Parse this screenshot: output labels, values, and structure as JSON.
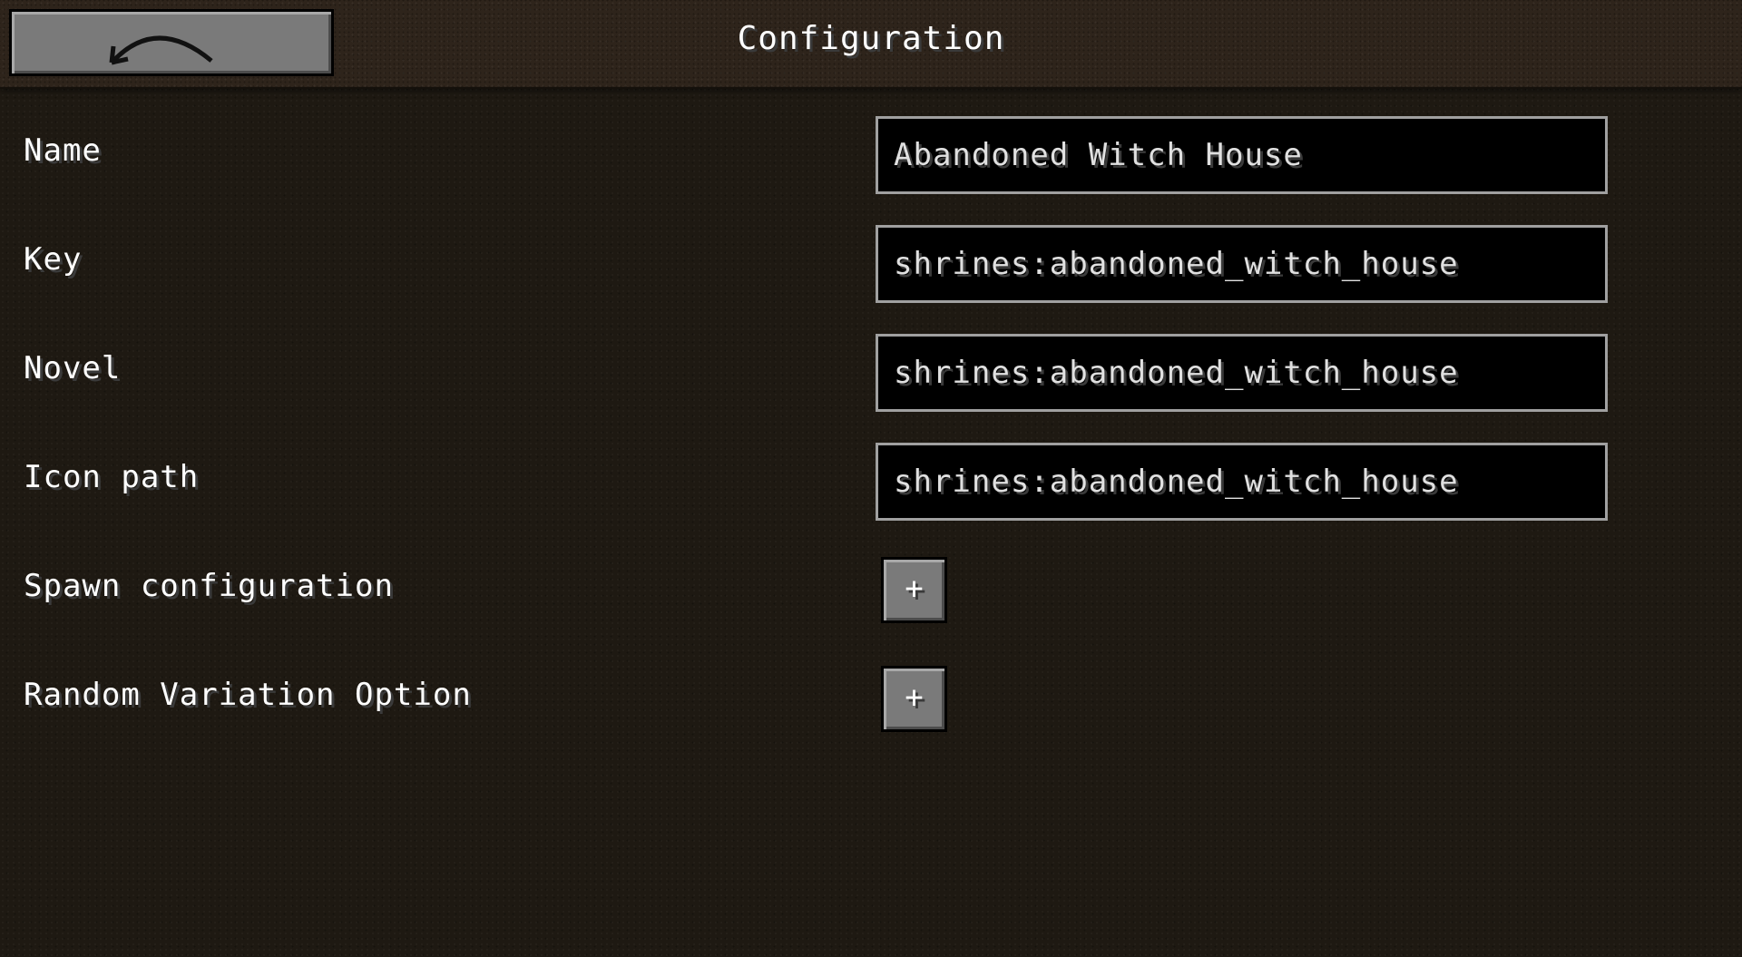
{
  "header": {
    "title": "Configuration",
    "back_icon": "back-arrow-icon"
  },
  "fields": {
    "name": {
      "label": "Name",
      "value": "Abandoned Witch House"
    },
    "key": {
      "label": "Key",
      "value": "shrines:abandoned_witch_house"
    },
    "novel": {
      "label": "Novel",
      "value": "shrines:abandoned_witch_house"
    },
    "icon_path": {
      "label": "Icon path",
      "value": "shrines:abandoned_witch_house"
    }
  },
  "lists": {
    "spawn_configuration": {
      "label": "Spawn configuration",
      "button": "+"
    },
    "random_variation_option": {
      "label": "Random Variation Option",
      "button": "+"
    }
  },
  "colors": {
    "background": "#1e1912",
    "header": "#2e241b",
    "button": "#7a7a7a",
    "field_border": "#a0a0a0"
  }
}
